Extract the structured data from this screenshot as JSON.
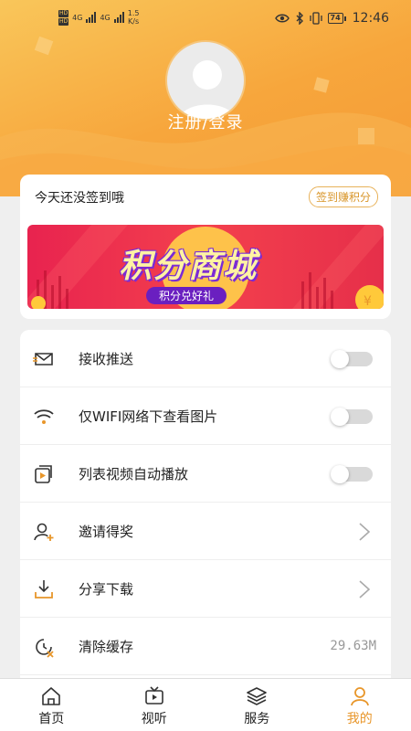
{
  "status_bar": {
    "hd1": "HD",
    "hd2": "HD",
    "net1": "4G",
    "net2": "4G",
    "speed_value": "1.5",
    "speed_unit": "K/s",
    "battery": "74",
    "time": "12:46"
  },
  "profile": {
    "login_label": "注册/登录"
  },
  "checkin": {
    "title": "今天还没签到哦",
    "button_label": "签到赚积分",
    "banner_title": "积分商城",
    "banner_subtitle": "积分兑好礼"
  },
  "settings": {
    "items": [
      {
        "label": "接收推送",
        "icon": "envelope-icon",
        "control": "toggle",
        "on": false
      },
      {
        "label": "仅WIFI网络下查看图片",
        "icon": "wifi-icon",
        "control": "toggle",
        "on": false
      },
      {
        "label": "列表视频自动播放",
        "icon": "video-play-icon",
        "control": "toggle",
        "on": false
      },
      {
        "label": "邀请得奖",
        "icon": "add-user-icon",
        "control": "chevron"
      },
      {
        "label": "分享下载",
        "icon": "download-icon",
        "control": "chevron"
      },
      {
        "label": "清除缓存",
        "icon": "clear-cache-icon",
        "control": "value",
        "value": "29.63M"
      }
    ]
  },
  "tabbar": {
    "tabs": [
      {
        "label": "首页",
        "icon": "home-icon",
        "active": false
      },
      {
        "label": "视听",
        "icon": "tv-icon",
        "active": false
      },
      {
        "label": "服务",
        "icon": "layers-icon",
        "active": false
      },
      {
        "label": "我的",
        "icon": "user-icon",
        "active": true
      }
    ]
  },
  "colors": {
    "accent": "#e8962a",
    "header_gradient_start": "#f9c65a",
    "header_gradient_end": "#f49a35",
    "banner_red": "#e8234f",
    "banner_purple": "#6a1fc0"
  }
}
